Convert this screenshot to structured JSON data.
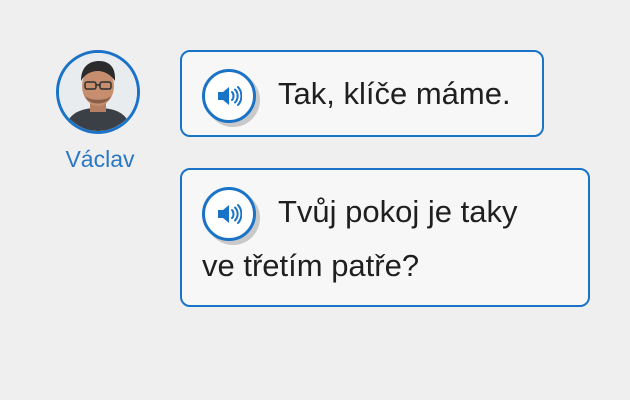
{
  "speaker": {
    "name": "Václav",
    "avatar_icon": "avatar-photo"
  },
  "messages": [
    {
      "audio_icon": "speaker-icon",
      "lines": [
        "Tak, klíče máme."
      ]
    },
    {
      "audio_icon": "speaker-icon",
      "lines": [
        "Tvůj pokoj je taky",
        "ve třetím patře?"
      ]
    }
  ],
  "colors": {
    "accent": "#1a73c7",
    "name_text": "#2a78c3",
    "background": "#efefef",
    "bubble_background": "#f7f7f7"
  }
}
